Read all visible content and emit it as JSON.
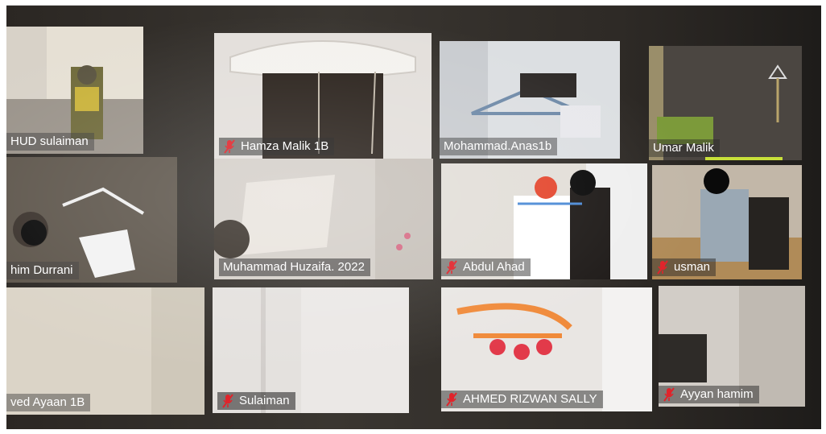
{
  "participants": [
    {
      "name": "HUD sulaiman",
      "muted": false
    },
    {
      "name": "Hamza Malik 1B",
      "muted": true
    },
    {
      "name": "Mohammad.Anas1b",
      "muted": false
    },
    {
      "name": "Umar Malik",
      "muted": false
    },
    {
      "name": "him Durrani",
      "muted": false
    },
    {
      "name": "Muhammad Huzaifa. 2022",
      "muted": false
    },
    {
      "name": "Abdul Ahad",
      "muted": true
    },
    {
      "name": "usman",
      "muted": true
    },
    {
      "name": "ved Ayaan 1B",
      "muted": false
    },
    {
      "name": "Sulaiman",
      "muted": true
    },
    {
      "name": "AHMED RIZWAN SALLY",
      "muted": true
    },
    {
      "name": "Ayyan hamim",
      "muted": true
    }
  ],
  "colors": {
    "mute_red": "#e0242b",
    "tag_background": "#1e1e1e",
    "active_speaker": "#c8e03a"
  },
  "icons": {
    "muted": "microphone-muted-icon"
  }
}
